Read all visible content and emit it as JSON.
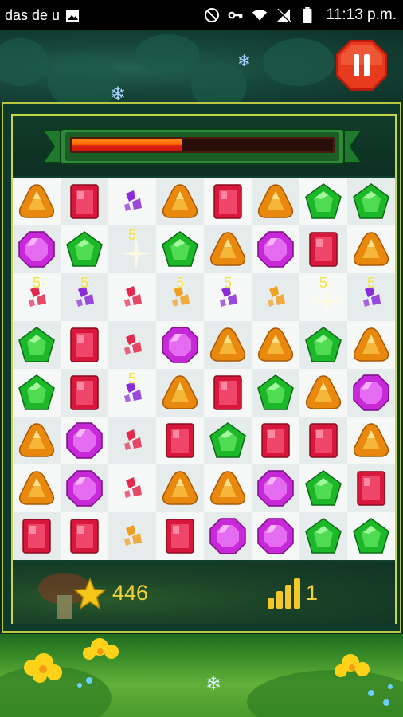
{
  "status_bar": {
    "notification_text": "das de u",
    "time": "11:13 p.m."
  },
  "game": {
    "score": "446",
    "level": "1",
    "progress_fraction": 0.42,
    "bonus_label": "5"
  },
  "colors": {
    "progress_fill": "#ff6a00",
    "score_text": "#f2d23a",
    "frame_border": "#c7d54a",
    "pause_button": "#e83a1c"
  },
  "board": {
    "rows": [
      [
        "orange-gem",
        "red-gem",
        "purple-shard",
        "orange-gem",
        "red-gem",
        "orange-gem",
        "green-gem",
        "green-gem"
      ],
      [
        "purple-gem",
        "green-gem",
        "sparkle-5",
        "green-gem",
        "orange-gem",
        "purple-gem",
        "red-gem",
        "orange-gem"
      ],
      [
        "red-shard-5",
        "purple-shard-5",
        "red-shard",
        "orange-shard-5",
        "purple-shard-5",
        "orange-shard",
        "sparkle-5",
        "purple-shard-5"
      ],
      [
        "green-gem",
        "red-gem",
        "red-shard",
        "purple-gem",
        "orange-gem",
        "orange-gem",
        "green-gem",
        "orange-gem"
      ],
      [
        "green-gem",
        "red-gem",
        "purple-shard-5",
        "orange-gem",
        "red-gem",
        "green-gem",
        "orange-gem",
        "purple-gem"
      ],
      [
        "orange-gem",
        "purple-gem",
        "red-shard",
        "red-gem",
        "green-gem",
        "red-gem",
        "red-gem",
        "orange-gem"
      ],
      [
        "orange-gem",
        "purple-gem",
        "red-shard",
        "orange-gem",
        "orange-gem",
        "purple-gem",
        "green-gem",
        "red-gem"
      ],
      [
        "red-gem",
        "red-gem",
        "orange-shard",
        "red-gem",
        "purple-gem",
        "purple-gem",
        "green-gem",
        "green-gem"
      ]
    ]
  },
  "icons": {
    "pause": "pause-icon",
    "star": "star-icon",
    "level": "level-bars-icon"
  }
}
